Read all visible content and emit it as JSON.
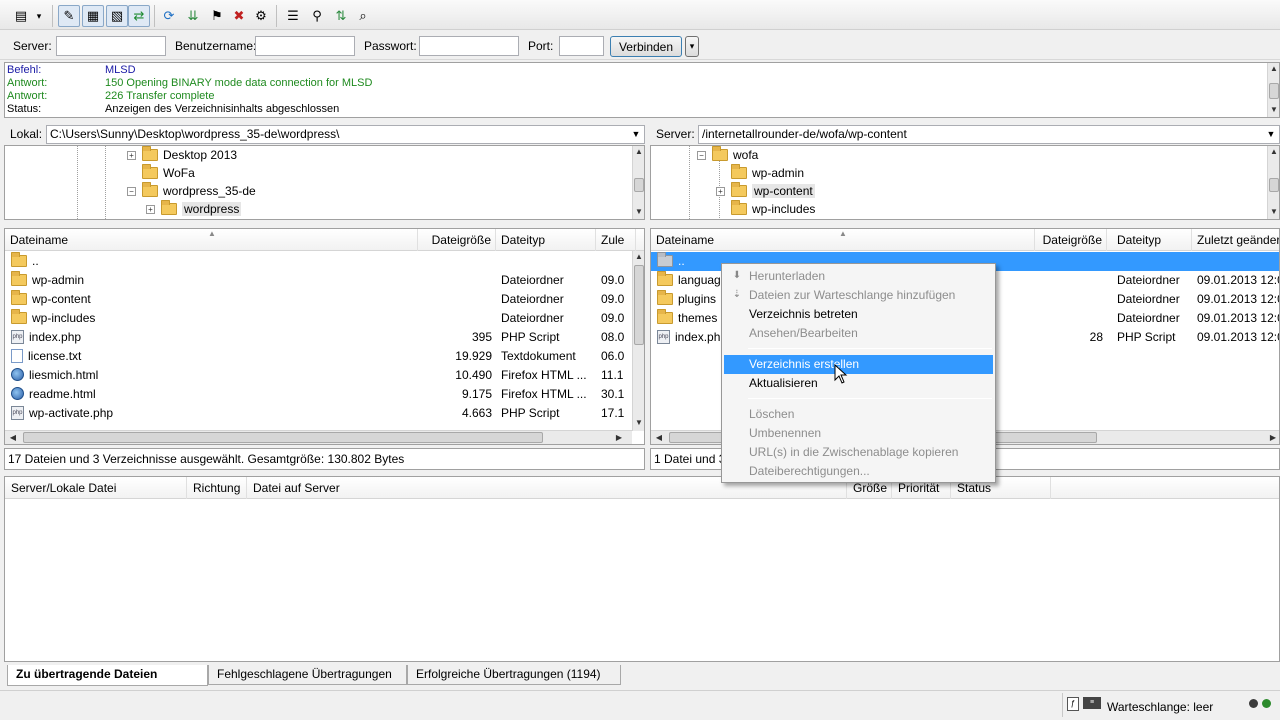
{
  "quickconnect": {
    "server_label": "Server:",
    "user_label": "Benutzername:",
    "pass_label": "Passwort:",
    "port_label": "Port:",
    "server_value": "",
    "user_value": "",
    "pass_value": "",
    "port_value": "",
    "connect_label": "Verbinden",
    "dropdown_glyph": "▾"
  },
  "log": [
    {
      "key": "Befehl:",
      "value": "MLSD",
      "color": "#1a1aa6"
    },
    {
      "key": "Antwort:",
      "value": "150 Opening BINARY mode data connection for MLSD",
      "color": "#1f8a1f"
    },
    {
      "key": "Antwort:",
      "value": "226 Transfer complete",
      "color": "#1f8a1f"
    },
    {
      "key": "Status:",
      "value": "Anzeigen des Verzeichnisinhalts abgeschlossen",
      "color": "#000000"
    }
  ],
  "local": {
    "path_label": "Lokal:",
    "path": "C:\\Users\\Sunny\\Desktop\\wordpress_35-de\\wordpress\\",
    "tree": [
      {
        "label": "Desktop 2013",
        "expander": "+"
      },
      {
        "label": "WoFa",
        "expander": ""
      },
      {
        "label": "wordpress_35-de",
        "expander": "−"
      },
      {
        "label": "wordpress",
        "expander": "+"
      }
    ],
    "columns": {
      "name": "Dateiname",
      "size": "Dateigröße",
      "type": "Dateityp",
      "modified": "Zule"
    },
    "files": [
      {
        "name": "..",
        "size": "",
        "type": "",
        "modified": "",
        "icon": "folder-icon"
      },
      {
        "name": "wp-admin",
        "size": "",
        "type": "Dateiordner",
        "modified": "09.0",
        "icon": "folder-icon"
      },
      {
        "name": "wp-content",
        "size": "",
        "type": "Dateiordner",
        "modified": "09.0",
        "icon": "folder-icon"
      },
      {
        "name": "wp-includes",
        "size": "",
        "type": "Dateiordner",
        "modified": "09.0",
        "icon": "folder-icon"
      },
      {
        "name": "index.php",
        "size": "395",
        "type": "PHP Script",
        "modified": "08.0",
        "icon": "php-file-icon"
      },
      {
        "name": "license.txt",
        "size": "19.929",
        "type": "Textdokument",
        "modified": "06.0",
        "icon": "text-file-icon"
      },
      {
        "name": "liesmich.html",
        "size": "10.490",
        "type": "Firefox HTML ...",
        "modified": "11.1",
        "icon": "html-file-icon"
      },
      {
        "name": "readme.html",
        "size": "9.175",
        "type": "Firefox HTML ...",
        "modified": "30.1",
        "icon": "html-file-icon"
      },
      {
        "name": "wp-activate.php",
        "size": "4.663",
        "type": "PHP Script",
        "modified": "17.1",
        "icon": "php-file-icon"
      }
    ],
    "status": "17 Dateien und 3 Verzeichnisse ausgewählt. Gesamtgröße: 130.802 Bytes"
  },
  "remote": {
    "path_label": "Server:",
    "path": "/internetallrounder-de/wofa/wp-content",
    "tree": [
      {
        "label": "wofa",
        "expander": "−"
      },
      {
        "label": "wp-admin",
        "expander": ""
      },
      {
        "label": "wp-content",
        "expander": "+"
      },
      {
        "label": "wp-includes",
        "expander": ""
      }
    ],
    "columns": {
      "name": "Dateiname",
      "size": "Dateigröße",
      "type": "Dateityp",
      "modified": "Zuletzt geändert"
    },
    "files": [
      {
        "name": "..",
        "size": "",
        "type": "",
        "modified": "",
        "icon": "folder-icon"
      },
      {
        "name": "language",
        "size": "",
        "type": "Dateiordner",
        "modified": "09.01.2013 12:0",
        "icon": "folder-icon"
      },
      {
        "name": "plugins",
        "size": "",
        "type": "Dateiordner",
        "modified": "09.01.2013 12:0",
        "icon": "folder-icon"
      },
      {
        "name": "themes",
        "size": "",
        "type": "Dateiordner",
        "modified": "09.01.2013 12:0",
        "icon": "folder-icon"
      },
      {
        "name": "index.php",
        "size": "28",
        "type": "PHP Script",
        "modified": "09.01.2013 12:0",
        "icon": "php-file-icon"
      }
    ],
    "status": "1 Datei und 3"
  },
  "context_menu": [
    {
      "label": "Herunterladen",
      "disabled": true,
      "icon": "download-icon"
    },
    {
      "label": "Dateien zur Warteschlange hinzufügen",
      "disabled": true,
      "icon": "queue-add-icon"
    },
    {
      "label": "Verzeichnis betreten",
      "disabled": false
    },
    {
      "label": "Ansehen/Bearbeiten",
      "disabled": true
    },
    {
      "sep": true
    },
    {
      "label": "Verzeichnis erstellen",
      "disabled": false,
      "highlight": true
    },
    {
      "label": "Aktualisieren",
      "disabled": false
    },
    {
      "sep": true
    },
    {
      "label": "Löschen",
      "disabled": true
    },
    {
      "label": "Umbenennen",
      "disabled": true
    },
    {
      "label": "URL(s) in die Zwischenablage kopieren",
      "disabled": true
    },
    {
      "label": "Dateiberechtigungen...",
      "disabled": true
    }
  ],
  "queue": {
    "columns": [
      "Server/Lokale Datei",
      "Richtung",
      "Datei auf Server",
      "Größe",
      "Priorität",
      "Status"
    ]
  },
  "tabs": [
    {
      "label": "Zu übertragende Dateien",
      "active": true
    },
    {
      "label": "Fehlgeschlagene Übertragungen",
      "active": false
    },
    {
      "label": "Erfolgreiche Übertragungen (1194)",
      "active": false
    }
  ],
  "statusbar": {
    "queue": "Warteschlange: leer"
  },
  "colors": {
    "selection": "#3399ff",
    "folder": "#f4c95d"
  }
}
